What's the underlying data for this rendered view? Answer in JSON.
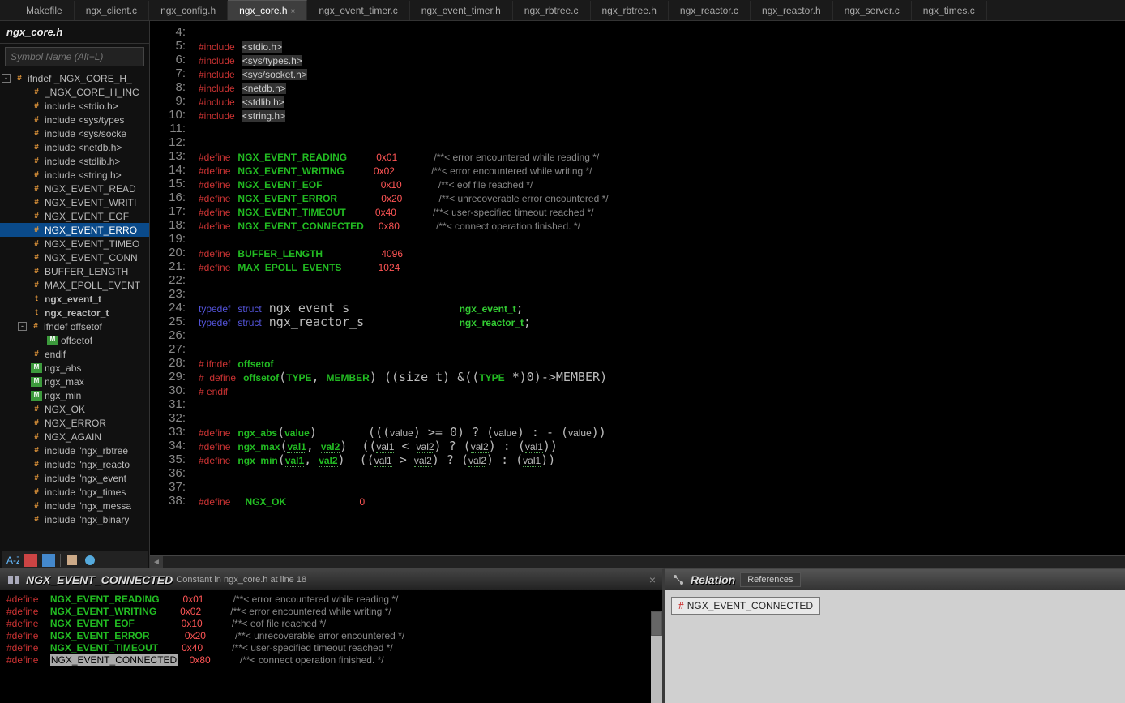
{
  "tabs": [
    {
      "label": "Makefile",
      "active": false
    },
    {
      "label": "ngx_client.c",
      "active": false
    },
    {
      "label": "ngx_config.h",
      "active": false
    },
    {
      "label": "ngx_core.h",
      "active": true
    },
    {
      "label": "ngx_event_timer.c",
      "active": false
    },
    {
      "label": "ngx_event_timer.h",
      "active": false
    },
    {
      "label": "ngx_rbtree.c",
      "active": false
    },
    {
      "label": "ngx_rbtree.h",
      "active": false
    },
    {
      "label": "ngx_reactor.c",
      "active": false
    },
    {
      "label": "ngx_reactor.h",
      "active": false
    },
    {
      "label": "ngx_server.c",
      "active": false
    },
    {
      "label": "ngx_times.c",
      "active": false
    }
  ],
  "sidebar": {
    "file": "ngx_core.h",
    "symbol_placeholder": "Symbol Name (Alt+L)",
    "nodes": [
      {
        "d": 0,
        "exp": "-",
        "ic": "#",
        "t": "ifndef _NGX_CORE_H_"
      },
      {
        "d": 1,
        "ic": "#",
        "t": "_NGX_CORE_H_INC"
      },
      {
        "d": 1,
        "ic": "#",
        "t": "include <stdio.h>"
      },
      {
        "d": 1,
        "ic": "#",
        "t": "include <sys/types"
      },
      {
        "d": 1,
        "ic": "#",
        "t": "include <sys/socke"
      },
      {
        "d": 1,
        "ic": "#",
        "t": "include <netdb.h>"
      },
      {
        "d": 1,
        "ic": "#",
        "t": "include <stdlib.h>"
      },
      {
        "d": 1,
        "ic": "#",
        "t": "include <string.h>"
      },
      {
        "d": 1,
        "ic": "#",
        "t": "NGX_EVENT_READ"
      },
      {
        "d": 1,
        "ic": "#",
        "t": "NGX_EVENT_WRITI"
      },
      {
        "d": 1,
        "ic": "#",
        "t": "NGX_EVENT_EOF"
      },
      {
        "d": 1,
        "ic": "#",
        "t": "NGX_EVENT_ERRO",
        "sel": true
      },
      {
        "d": 1,
        "ic": "#",
        "t": "NGX_EVENT_TIMEO"
      },
      {
        "d": 1,
        "ic": "#",
        "t": "NGX_EVENT_CONN"
      },
      {
        "d": 1,
        "ic": "#",
        "t": "BUFFER_LENGTH"
      },
      {
        "d": 1,
        "ic": "#",
        "t": "MAX_EPOLL_EVENT"
      },
      {
        "d": 1,
        "ic": "t",
        "t": "ngx_event_t",
        "bold": true
      },
      {
        "d": 1,
        "ic": "t",
        "t": "ngx_reactor_t",
        "bold": true
      },
      {
        "d": 1,
        "exp": "-",
        "ic": "#",
        "t": "ifndef offsetof"
      },
      {
        "d": 2,
        "ic": "M",
        "t": "offsetof"
      },
      {
        "d": 1,
        "ic": "#",
        "t": "endif"
      },
      {
        "d": 1,
        "ic": "M",
        "t": "ngx_abs"
      },
      {
        "d": 1,
        "ic": "M",
        "t": "ngx_max"
      },
      {
        "d": 1,
        "ic": "M",
        "t": "ngx_min"
      },
      {
        "d": 1,
        "ic": "#",
        "t": "NGX_OK"
      },
      {
        "d": 1,
        "ic": "#",
        "t": "NGX_ERROR"
      },
      {
        "d": 1,
        "ic": "#",
        "t": "NGX_AGAIN"
      },
      {
        "d": 1,
        "ic": "#",
        "t": "include \"ngx_rbtree"
      },
      {
        "d": 1,
        "ic": "#",
        "t": "include \"ngx_reacto"
      },
      {
        "d": 1,
        "ic": "#",
        "t": "include \"ngx_event"
      },
      {
        "d": 1,
        "ic": "#",
        "t": "include \"ngx_times"
      },
      {
        "d": 1,
        "ic": "#",
        "t": "include \"ngx_messa"
      },
      {
        "d": 1,
        "ic": "#",
        "t": "include \"ngx_binary"
      }
    ]
  },
  "code": {
    "first_line": 4,
    "lines": [
      "",
      "<span class='kw'>#include</span> <span class='str'>&lt;stdio.h&gt;</span>",
      "<span class='kw'>#include</span> <span class='str'>&lt;sys/types.h&gt;</span>",
      "<span class='kw'>#include</span> <span class='str'>&lt;sys/socket.h&gt;</span>",
      "<span class='kw'>#include</span> <span class='str'>&lt;netdb.h&gt;</span>",
      "<span class='kw'>#include</span> <span class='str'>&lt;stdlib.h&gt;</span>",
      "<span class='kw'>#include</span> <span class='str'>&lt;string.h&gt;</span>",
      "",
      "",
      "<span class='kw'>#define</span> <span class='mac'>NGX_EVENT_READING</span>    <span class='num'>0x01</span>     <span class='cmt'>/**&lt; error encountered while reading */</span>",
      "<span class='kw'>#define</span> <span class='mac'>NGX_EVENT_WRITING</span>    <span class='num'>0x02</span>     <span class='cmt'>/**&lt; error encountered while writing */</span>",
      "<span class='kw'>#define</span> <span class='mac'>NGX_EVENT_EOF</span>        <span class='num'>0x10</span>     <span class='cmt'>/**&lt; eof file reached */</span>",
      "<span class='kw'>#define</span> <span class='mac'>NGX_EVENT_ERROR</span>      <span class='num'>0x20</span>     <span class='cmt'>/**&lt; unrecoverable error encountered */</span>",
      "<span class='kw'>#define</span> <span class='mac'>NGX_EVENT_TIMEOUT</span>    <span class='num'>0x40</span>     <span class='cmt'>/**&lt; user-specified timeout reached */</span>",
      "<span class='kw'>#define</span> <span class='mac'>NGX_EVENT_CONNECTED</span>  <span class='num'>0x80</span>     <span class='cmt'>/**&lt; connect operation finished. */</span>",
      "",
      "<span class='kw'>#define</span> <span class='mac'>BUFFER_LENGTH</span>        <span class='num'>4096</span>",
      "<span class='kw'>#define</span> <span class='mac'>MAX_EPOLL_EVENTS</span>     <span class='num'>1024</span>",
      "",
      "",
      "<span class='kw2'>typedef</span> <span class='kw2'>struct</span> ngx_event_s               <span class='typ'>ngx_event_t</span>;",
      "<span class='kw2'>typedef</span> <span class='kw2'>struct</span> ngx_reactor_s             <span class='typ'>ngx_reactor_t</span>;",
      "",
      "",
      "<span class='kw'># ifndef</span> <span class='mac'>offsetof</span>",
      "<span class='kw'>#  define</span> <span class='mac'>offsetof</span>(<span class='mac ud'>TYPE</span>, <span class='mac ud'>MEMBER</span>) ((size_t) &amp;((<span class='mac ud'>TYPE</span> *)0)-&gt;MEMBER)",
      "<span class='kw'># endif</span>",
      "",
      "",
      "<span class='kw'>#define</span> <span class='mac'>ngx_abs</span>(<span class='mac ud'>value</span>)       (((<span class='ud'>value</span>) &gt;= 0) ? (<span class='ud'>value</span>) : - (<span class='ud'>value</span>))",
      "<span class='kw'>#define</span> <span class='mac'>ngx_max</span>(<span class='mac ud'>val1</span>, <span class='mac ud'>val2</span>)  ((<span class='ud'>val1</span> &lt; <span class='ud'>val2</span>) ? (<span class='ud'>val2</span>) : (<span class='ud'>val1</span>))",
      "<span class='kw'>#define</span> <span class='mac'>ngx_min</span>(<span class='mac ud'>val1</span>, <span class='mac ud'>val2</span>)  ((<span class='ud'>val1</span> &gt; <span class='ud'>val2</span>) ? (<span class='ud'>val2</span>) : (<span class='ud'>val1</span>))",
      "",
      "",
      "<span class='kw'>#define</span>  <span class='mac'>NGX_OK</span>          <span class='num'>0</span>"
    ]
  },
  "context_panel": {
    "title": "NGX_EVENT_CONNECTED",
    "subtitle": "Constant in ngx_core.h at line 18",
    "rows": [
      "<span class='kw'>#define</span>  <span class='mac'>NGX_EVENT_READING</span>    <span class='num'>0x01</span>     <span class='cmt'>/**&lt; error encountered while reading */</span>",
      "<span class='kw'>#define</span>  <span class='mac'>NGX_EVENT_WRITING</span>    <span class='num'>0x02</span>     <span class='cmt'>/**&lt; error encountered while writing */</span>",
      "<span class='kw'>#define</span>  <span class='mac'>NGX_EVENT_EOF</span>        <span class='num'>0x10</span>     <span class='cmt'>/**&lt; eof file reached */</span>",
      "<span class='kw'>#define</span>  <span class='mac'>NGX_EVENT_ERROR</span>      <span class='num'>0x20</span>     <span class='cmt'>/**&lt; unrecoverable error encountered */</span>",
      "<span class='kw'>#define</span>  <span class='mac'>NGX_EVENT_TIMEOUT</span>    <span class='num'>0x40</span>     <span class='cmt'>/**&lt; user-specified timeout reached */</span>",
      "<span class='kw'>#define</span>  <span class='hl'>NGX_EVENT_CONNECTED</span>  <span class='num'>0x80</span>     <span class='cmt'>/**&lt; connect operation finished. */</span>"
    ]
  },
  "relation_panel": {
    "title": "Relation",
    "tab": "References",
    "item": "NGX_EVENT_CONNECTED"
  }
}
